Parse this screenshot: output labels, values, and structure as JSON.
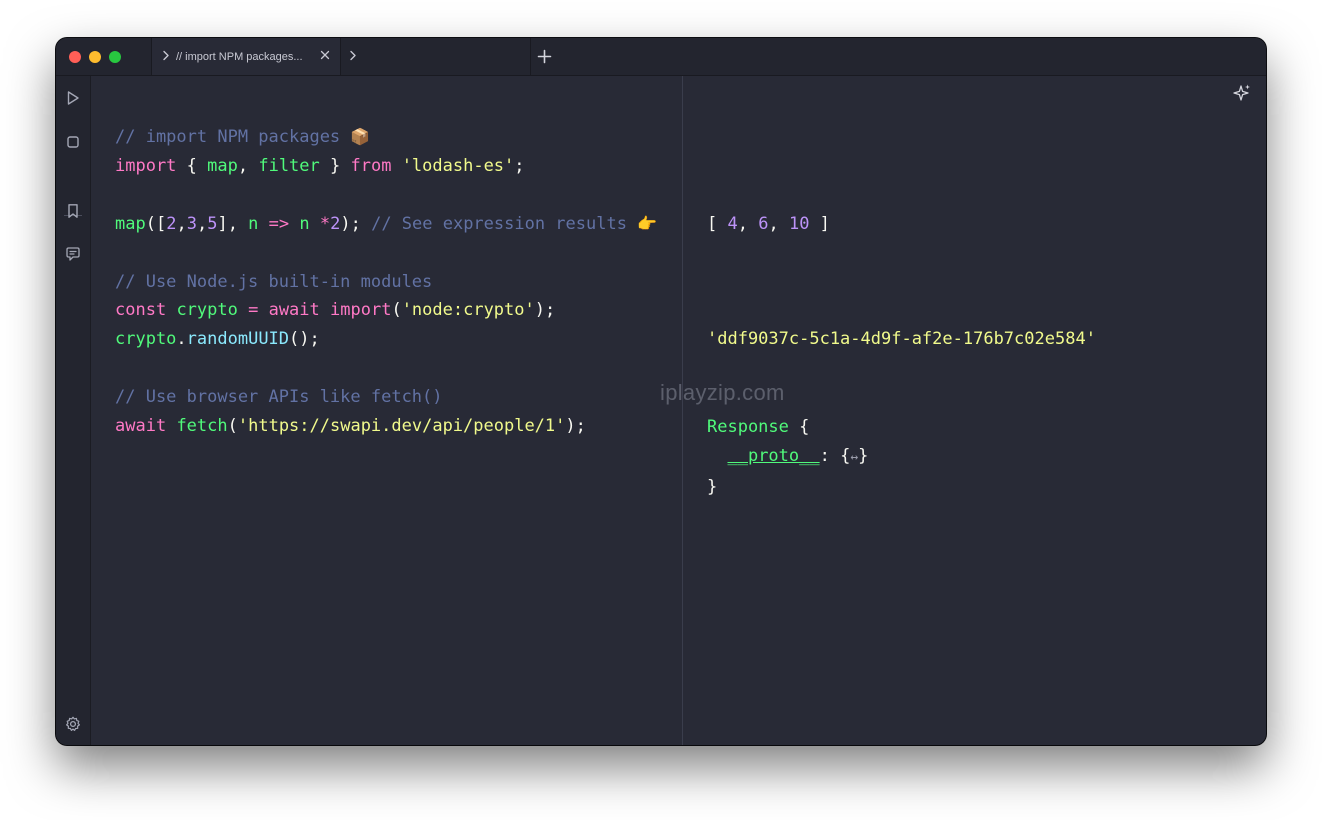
{
  "tabs": [
    {
      "title": "// import NPM packages..."
    },
    {
      "title": ""
    }
  ],
  "code": {
    "line1": {
      "comment": "// import NPM packages",
      "emoji": "📦"
    },
    "line2": {
      "import_kw": "import",
      "open_brace": " { ",
      "map": "map",
      "comma": ", ",
      "filter": "filter",
      "close_brace": " } ",
      "from_kw": "from",
      "space": " ",
      "module": "'lodash-es'",
      "semicolon": ";"
    },
    "line4": {
      "map": "map",
      "p1": "([",
      "n1": "2",
      "c1": ",",
      "n2": "3",
      "c2": ",",
      "n3": "5",
      "p2": "], ",
      "arg": "n",
      "arrow": " => ",
      "arg2": "n",
      "op": " *",
      "n4": "2",
      "p3": "); ",
      "comment": "// See expression results",
      "emoji": "👉"
    },
    "line6": {
      "comment": "// Use Node.js built-in modules"
    },
    "line7": {
      "const_kw": "const",
      "space": " ",
      "var": "crypto",
      "eq": " = ",
      "await_kw": "await",
      "space2": " ",
      "import_kw": "import",
      "p1": "(",
      "module": "'node:crypto'",
      "p2": ");"
    },
    "line8": {
      "obj": "crypto",
      "dot": ".",
      "method": "randomUUID",
      "call": "();"
    },
    "line10": {
      "comment": "// Use browser APIs like fetch()"
    },
    "line11": {
      "await_kw": "await",
      "space": " ",
      "fetch": "fetch",
      "p1": "(",
      "url": "'https://swapi.dev/api/people/1'",
      "p2": ");"
    }
  },
  "results": {
    "array": {
      "open": "[ ",
      "v1": "4",
      "sep1": ", ",
      "v2": "6",
      "sep2": ", ",
      "v3": "10",
      "close": " ]"
    },
    "uuid": "'ddf9037c-5c1a-4d9f-af2e-176b7c02e584'",
    "response": {
      "name": "Response",
      "open": " {",
      "indent": "  ",
      "proto_key": "__proto__",
      "colon": ": ",
      "proto_open": "{",
      "proto_expand": "↔",
      "proto_close": "}",
      "close": "}"
    }
  },
  "watermark": "iplayzip.com",
  "icons": {
    "sidebar": [
      "play-icon",
      "stop-icon",
      "bookmark-icon",
      "chat-icon",
      "gear-icon"
    ],
    "tabs": [
      "chevron-right-icon",
      "close-icon",
      "plus-icon"
    ],
    "results": "sparkle-icon"
  },
  "colors": {
    "window_bg": "#282a36",
    "titlebar_bg": "#23252f",
    "comment": "#6272a4",
    "keyword": "#ff79c6",
    "function": "#50fa7b",
    "number": "#bd93f9",
    "string": "#f1fa8c",
    "method": "#8be9fd"
  }
}
